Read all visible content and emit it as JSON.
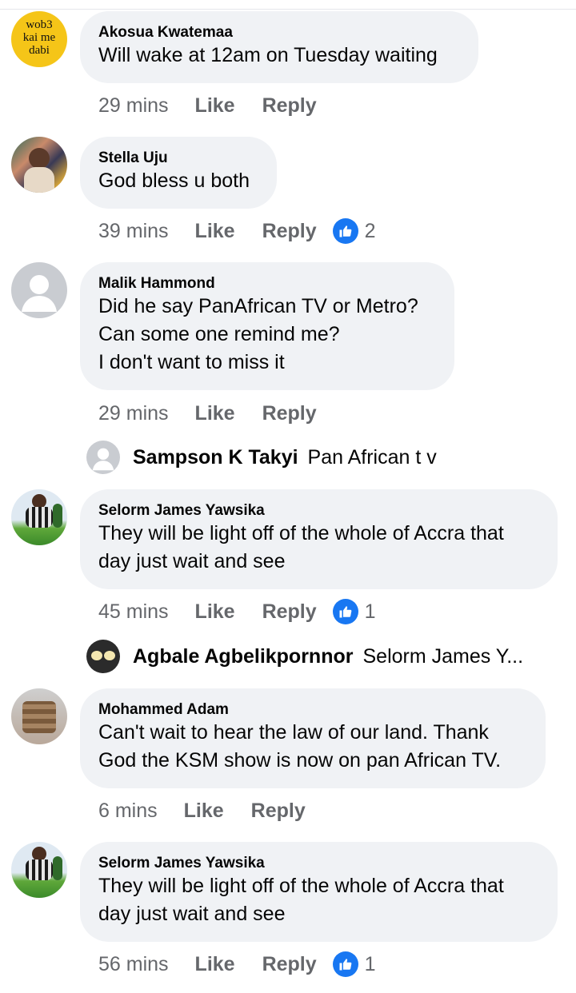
{
  "comments": [
    {
      "author": "Akosua Kwatemaa",
      "avatar_text": [
        "wob3",
        "kai me",
        "dabi"
      ],
      "lines": [
        "Will wake at 12am on Tuesday waiting"
      ],
      "time": "29 mins",
      "like": "Like",
      "reply": "Reply",
      "reactions": null
    },
    {
      "author": "Stella Uju",
      "lines": [
        "God bless u both"
      ],
      "time": "39 mins",
      "like": "Like",
      "reply": "Reply",
      "reactions": "2"
    },
    {
      "author": "Malik Hammond",
      "lines": [
        "Did he say PanAfrican TV or Metro?",
        "Can some one remind me?",
        "I don't want to miss it"
      ],
      "time": "29 mins",
      "like": "Like",
      "reply": "Reply",
      "reactions": null
    },
    {
      "author": "Selorm James Yawsika",
      "lines": [
        "They will be light off of the whole of Accra that",
        "day just wait and see"
      ],
      "time": "45 mins",
      "like": "Like",
      "reply": "Reply",
      "reactions": "1"
    },
    {
      "author": "Mohammed Adam",
      "lines": [
        "Can't wait to hear the law of our land. Thank",
        "God the KSM show is now on pan African TV."
      ],
      "time": "6 mins",
      "like": "Like",
      "reply": "Reply",
      "reactions": null
    },
    {
      "author": "Selorm James Yawsika",
      "lines": [
        "They will be light off of the whole of Accra that",
        "day just wait and see"
      ],
      "time": "56 mins",
      "like": "Like",
      "reply": "Reply",
      "reactions": "1"
    }
  ],
  "replies": [
    {
      "author": "Sampson K Takyi",
      "text": "Pan African t v"
    },
    {
      "author": "Agbale Agbelikpornnor",
      "text": "Selorm James Y..."
    }
  ],
  "colors": {
    "bubble": "#f0f2f5",
    "meta": "#65676b",
    "accent": "#1877f2"
  }
}
